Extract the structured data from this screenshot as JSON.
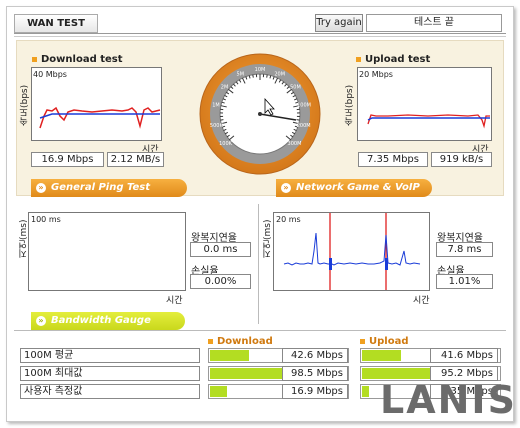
{
  "header": {
    "tab_label": "WAN TEST",
    "try_again_label": "Try again",
    "status_text": "테스트 끝"
  },
  "download": {
    "title": "Download test",
    "y_axis": "속도(bps)",
    "scale": "40 Mbps",
    "x_axis": "시간",
    "speed_mbps": "16.9 Mbps",
    "speed_mbs": "2.12 MB/s"
  },
  "upload": {
    "title": "Upload test",
    "y_axis": "속도(bps)",
    "scale": "20 Mbps",
    "x_axis": "시간",
    "speed_mbps": "7.35 Mbps",
    "speed_kbs": "919 kB/s"
  },
  "gauge": {
    "ticks": [
      "100K",
      "500K",
      "1M",
      "2M",
      "5M",
      "10M",
      "20M",
      "50M",
      "100M",
      "200M",
      "300M"
    ]
  },
  "ping": {
    "banner": "General Ping Test",
    "y_axis": "지연(ms)",
    "scale": "100 ms",
    "x_axis": "시간",
    "rtt_label": "왕복지연율",
    "rtt_value": "0.0 ms",
    "loss_label": "손실율",
    "loss_value": "0.00%"
  },
  "game": {
    "banner": "Network Game & VoIP Test",
    "y_axis": "지연(ms)",
    "scale": "20 ms",
    "x_axis": "시간",
    "rtt_label": "왕복지연율",
    "rtt_value": "7.8 ms",
    "loss_label": "손실율",
    "loss_value": "1.01%"
  },
  "bandwidth": {
    "banner": "Bandwidth Gauge",
    "download_label": "Download",
    "upload_label": "Upload",
    "rows": [
      {
        "label": "100M 평균",
        "download": "42.6 Mbps",
        "download_level": 0.28,
        "upload": "41.6 Mbps",
        "upload_level": 0.28
      },
      {
        "label": "100M 최대값",
        "download": "98.5 Mbps",
        "download_level": 0.66,
        "upload": "95.2 Mbps",
        "upload_level": 0.64
      },
      {
        "label": "사용자 측정값",
        "download": "16.9 Mbps",
        "download_level": 0.12,
        "upload": "7.35 Mbps",
        "upload_level": 0.05
      }
    ]
  },
  "watermark": "LANIS",
  "colors": {
    "orange": "#f0a020",
    "lime": "#b3dd22",
    "beige": "#f8f2e0",
    "red": "#e02020",
    "blue": "#1a3cd8"
  }
}
